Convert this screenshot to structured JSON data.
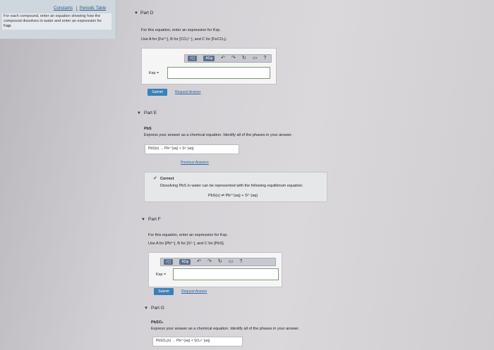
{
  "sidebar": {
    "links": [
      "Constants",
      "Periodic Table"
    ],
    "separator": "|",
    "help_text": "For each compound, enter an equation showing how the compound dissolves in water and enter an expression for K"
  },
  "part_d": {
    "title": "Part D",
    "instruction": "For this equation, enter an expression for Ksp.",
    "use_text": "Use A for [Fe²⁺], B for [CO₃²⁻], and C for [FeCO₃].",
    "answer_label": "Ksp =",
    "answer_value": "",
    "submit_label": "Submit",
    "request_label": "Request Answer"
  },
  "toolbar": {
    "btn1": "√▢",
    "btn2": "ΑΣφ",
    "icons": [
      "↶",
      "↷",
      "↻",
      "▭",
      "?"
    ]
  },
  "part_e": {
    "title": "Part E",
    "compound": "PbS",
    "instruction": "Express your answer as a chemical equation. Identify all of the phases in your answer.",
    "entered_equation": "PbS(s) → Pb²⁺(aq) + S²⁻(aq)",
    "previous_answers": "Previous Answers",
    "correct_title": "Correct",
    "correct_text": "Dissolving PbS in water can be represented with the following equilibrium equation:",
    "correct_equation": "PbS(s) ⇌ Pb²⁺(aq) + S²⁻(aq)"
  },
  "part_f": {
    "title": "Part F",
    "instruction": "For this equation, enter an expression for Ksp.",
    "use_text": "Use A for [Pb²⁺], B for [S²⁻], and C for [PbS].",
    "answer_label": "Ksp =",
    "answer_value": "",
    "submit_label": "Submit",
    "request_label": "Request Answer"
  },
  "part_g": {
    "title": "Part G",
    "compound": "PbSO₄",
    "instruction": "Express your answer as a chemical equation. Identify all of the phases in your answer.",
    "entered_equation": "PbSO₄(s) → Pb²⁺(aq) + SO₄²⁻(aq)"
  }
}
